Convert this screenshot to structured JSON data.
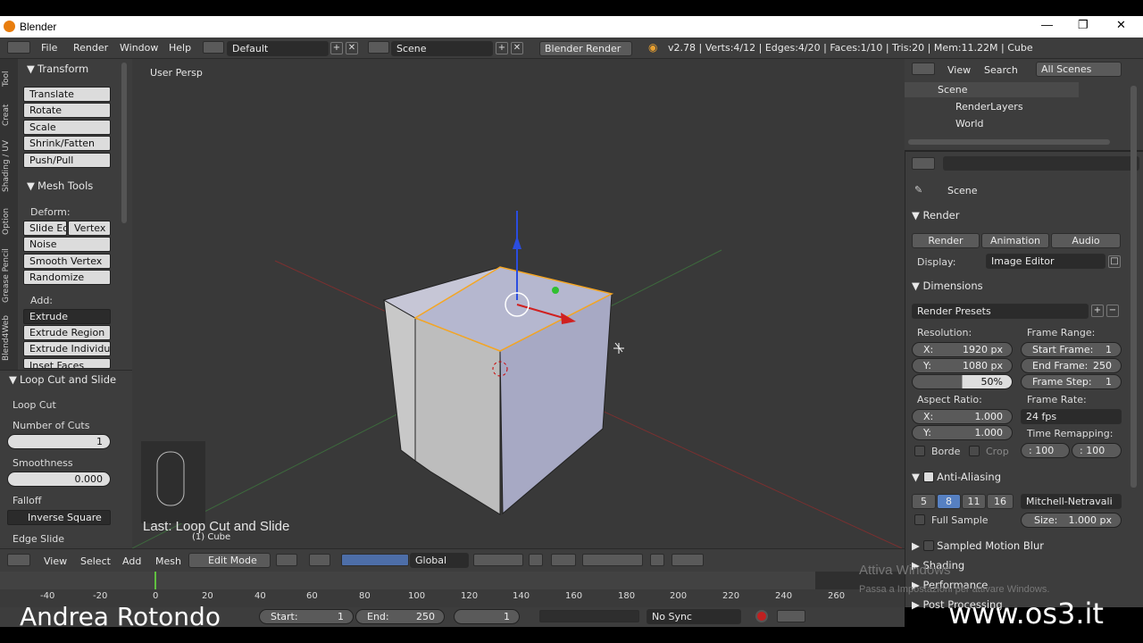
{
  "window": {
    "title": "Blender"
  },
  "menubar": {
    "menus": [
      "File",
      "Render",
      "Window",
      "Help"
    ],
    "layout": "Default",
    "scene": "Scene",
    "engine": "Blender Render",
    "stats": "v2.78 | Verts:4/12 | Edges:4/20 | Faces:1/10 | Tris:20 | Mem:11.22M | Cube"
  },
  "tabs": [
    "Tool",
    "Creat",
    "Shading / UV",
    "Option",
    "Grease Pencil",
    "Blend4Web"
  ],
  "toolshelf": {
    "transform": {
      "title": "Transform",
      "buttons": [
        "Translate",
        "Rotate",
        "Scale",
        "Shrink/Fatten",
        "Push/Pull"
      ]
    },
    "mesh_tools": {
      "title": "Mesh Tools",
      "deform_label": "Deform:",
      "slide_edge": "Slide Ed",
      "vertex": "Vertex",
      "buttons": [
        "Noise",
        "Smooth Vertex",
        "Randomize"
      ],
      "add_label": "Add:",
      "add_buttons": [
        "Extrude",
        "Extrude Region",
        "Extrude Individual",
        "Inset Faces"
      ]
    },
    "operator": {
      "title": "Loop Cut and Slide",
      "subtitle": "Loop Cut",
      "cuts_label": "Number of Cuts",
      "cuts_value": "1",
      "smooth_label": "Smoothness",
      "smooth_value": "0.000",
      "falloff_label": "Falloff",
      "falloff_value": "Inverse Square",
      "edge_slide": "Edge Slide"
    }
  },
  "viewport": {
    "view_label": "User Persp",
    "last_op": "Last: Loop Cut and Slide",
    "object_label": "(1) Cube"
  },
  "outliner": {
    "view": "View",
    "search": "Search",
    "filter": "All Scenes",
    "items": [
      "Scene",
      "RenderLayers",
      "World"
    ]
  },
  "properties": {
    "context": "Scene",
    "render": {
      "title": "Render",
      "render_btn": "Render",
      "animation_btn": "Animation",
      "audio_btn": "Audio",
      "display_label": "Display:",
      "display_value": "Image Editor"
    },
    "dimensions": {
      "title": "Dimensions",
      "presets": "Render Presets",
      "resolution_label": "Resolution:",
      "x": "1920 px",
      "y": "1080 px",
      "pct": "50%",
      "frame_range_label": "Frame Range:",
      "start": "1",
      "end": "250",
      "step": "1",
      "start_label": "Start Frame:",
      "end_label": "End Frame:",
      "step_label": "Frame Step:",
      "aspect_label": "Aspect Ratio:",
      "ax": "1.000",
      "ay": "1.000",
      "frame_rate_label": "Frame Rate:",
      "fps": "24 fps",
      "time_remap_label": "Time Remapping:",
      "remap_old": ": 100",
      "remap_new": ": 100",
      "border": "Borde",
      "crop": "Crop"
    },
    "aa": {
      "title": "Anti-Aliasing",
      "samples": [
        "5",
        "8",
        "11",
        "16"
      ],
      "filter": "Mitchell-Netravali",
      "full_sample": "Full Sample",
      "size_label": "Size:",
      "size_value": "1.000 px"
    },
    "sections": [
      "Sampled Motion Blur",
      "Shading",
      "Performance",
      "Post Processing"
    ]
  },
  "vpheader": {
    "view": "View",
    "select": "Select",
    "add": "Add",
    "mesh": "Mesh",
    "mode": "Edit Mode",
    "orientation": "Global"
  },
  "timeline": {
    "ticks": [
      "-40",
      "-20",
      "0",
      "20",
      "40",
      "60",
      "80",
      "100",
      "120",
      "140",
      "160",
      "180",
      "200",
      "220",
      "240",
      "260"
    ],
    "start_label": "Start:",
    "start": "1",
    "end_label": "End:",
    "end": "250",
    "current": "1",
    "sync": "No Sync"
  },
  "overlay": {
    "author": "Andrea Rotondo",
    "site": "www.os3.it",
    "activate_title": "Attiva Windows",
    "activate_sub": "Passa a Impostazioni per attivare Windows."
  }
}
